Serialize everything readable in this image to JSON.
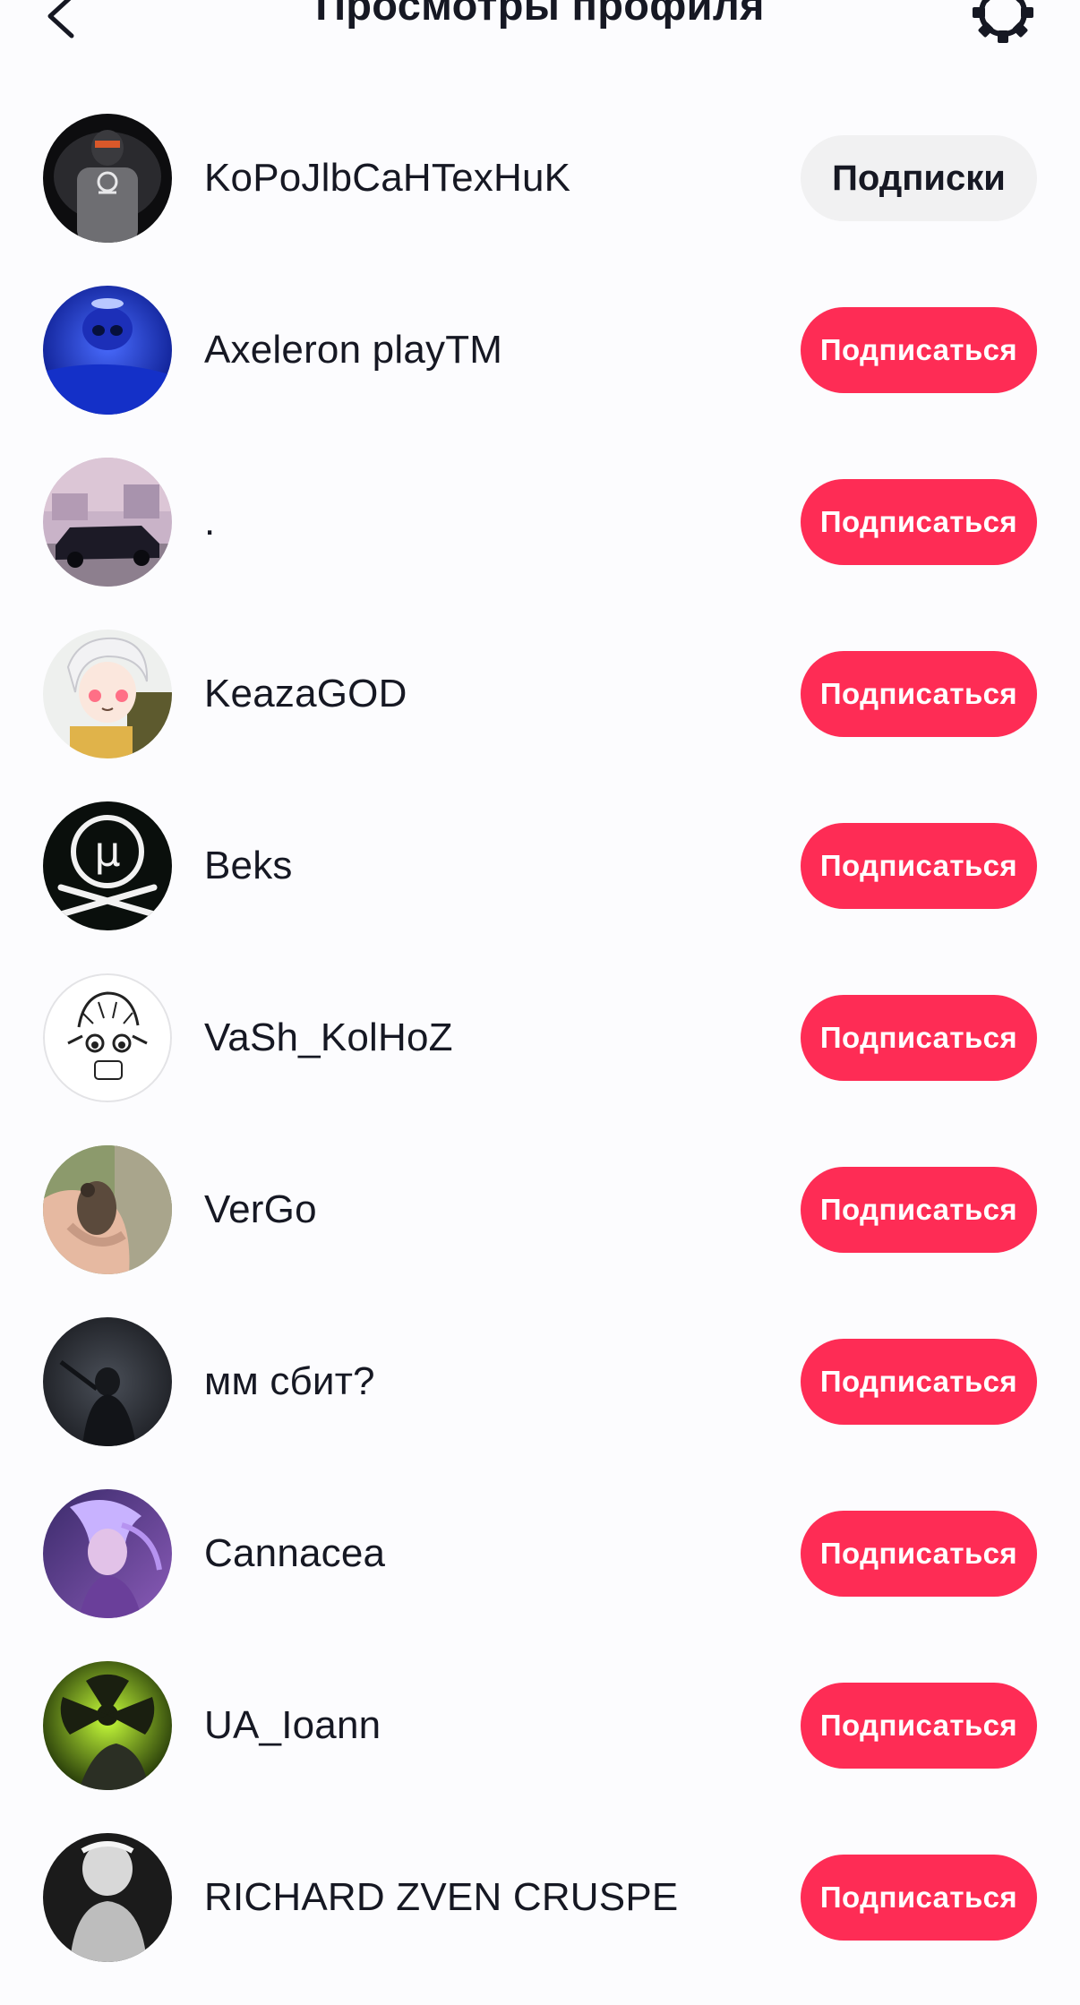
{
  "header": {
    "title": "Просмотры профиля",
    "back_icon": "chevron-left-icon",
    "settings_icon": "gear-icon"
  },
  "colors": {
    "follow_button": "#fe2c55",
    "following_button": "#f1f1f2",
    "text": "#161823",
    "background": "#fcfcfe"
  },
  "viewers": [
    {
      "name": "KoPoJlbCaHTexHuK",
      "button": "Подписки",
      "state": "following"
    },
    {
      "name": "Axeleron playTM",
      "button": "Подписаться",
      "state": "follow"
    },
    {
      "name": ".",
      "button": "Подписаться",
      "state": "follow"
    },
    {
      "name": "KeazaGOD",
      "button": "Подписаться",
      "state": "follow"
    },
    {
      "name": "Beks",
      "button": "Подписаться",
      "state": "follow"
    },
    {
      "name": "VaSh_KolHoZ",
      "button": "Подписаться",
      "state": "follow"
    },
    {
      "name": "VerGo",
      "button": "Подписаться",
      "state": "follow"
    },
    {
      "name": "мм сбит?",
      "button": "Подписаться",
      "state": "follow"
    },
    {
      "name": "Cannacea",
      "button": "Подписаться",
      "state": "follow"
    },
    {
      "name": "UA_Ioann",
      "button": "Подписаться",
      "state": "follow"
    },
    {
      "name": "RICHARD ZVEN CRUSPE",
      "button": "Подписаться",
      "state": "follow"
    }
  ]
}
